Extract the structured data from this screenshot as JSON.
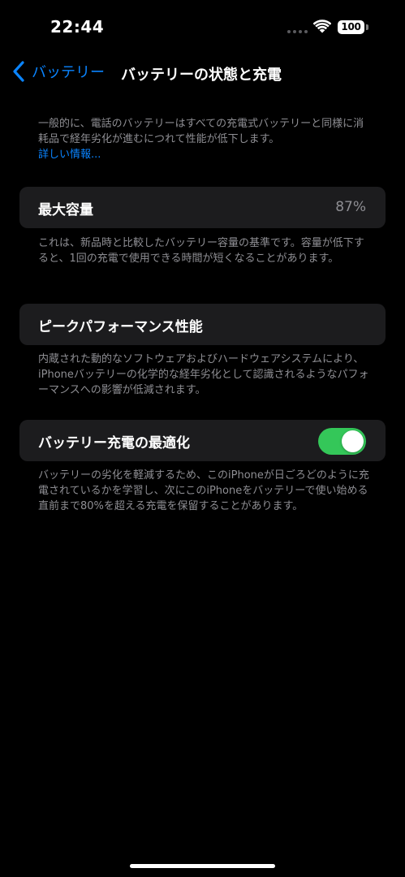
{
  "status_bar": {
    "time": "22:44",
    "battery_level": "100"
  },
  "nav": {
    "back_label": "バッテリー",
    "title": "バッテリーの状態と充電"
  },
  "intro": {
    "text": "一般的に、電話のバッテリーはすべての充電式バッテリーと同様に消耗品で経年劣化が進むにつれて性能が低下します。",
    "learn_more": "詳しい情報..."
  },
  "max_capacity": {
    "label": "最大容量",
    "value": "87%",
    "footnote": "これは、新品時と比較したバッテリー容量の基準です。容量が低下すると、1回の充電で使用できる時間が短くなることがあります。"
  },
  "peak_performance": {
    "label": "ピークパフォーマンス性能",
    "footnote": "内蔵された動的なソフトウェアおよびハードウェアシステムにより、iPhoneバッテリーの化学的な経年劣化として認識されるようなパフォーマンスへの影響が低減されます。"
  },
  "optimized_charging": {
    "label": "バッテリー充電の最適化",
    "enabled": true,
    "footnote": "バッテリーの劣化を軽減するため、このiPhoneが日ごろどのように充電されているかを学習し、次にこのiPhoneをバッテリーで使い始める直前まで80%を超える充電を保留することがあります。"
  },
  "colors": {
    "background": "#000000",
    "card": "#1c1c1e",
    "accent": "#0a84ff",
    "toggle_on": "#34c759",
    "secondary_text": "#8e8e93"
  }
}
